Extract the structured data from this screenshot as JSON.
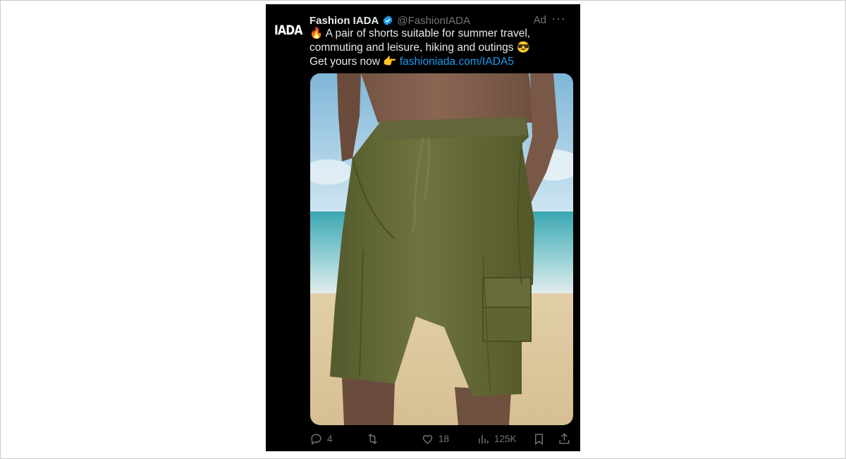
{
  "tweet": {
    "logo_text": "IADA",
    "display_name": "Fashion IADA",
    "handle": "@FashionIADA",
    "ad_label": "Ad",
    "more_label": "···",
    "lines": [
      {
        "emoji": "🔥",
        "text": "A pair of shorts suitable for summer travel,"
      },
      {
        "text": "commuting and leisure, hiking and outings",
        "emoji_after": "😎"
      },
      {
        "text": "Get yours now",
        "emoji_after": "👉",
        "link": "fashioniada.com/IADA5"
      }
    ],
    "media_icon": "shorts-on-beach-photo",
    "actions": {
      "replies": "4",
      "reposts": "",
      "likes": "18",
      "views": "125K"
    }
  },
  "colors": {
    "background": "#000000",
    "text": "#e7e9ea",
    "secondary": "#71767b",
    "link": "#1d9bf0",
    "verified": "#1d9bf0",
    "shorts": "#6b6d3a"
  },
  "icons": [
    "verified-badge-icon",
    "more-icon",
    "reply-icon",
    "repost-icon",
    "like-icon",
    "views-icon",
    "bookmark-icon",
    "share-icon"
  ]
}
